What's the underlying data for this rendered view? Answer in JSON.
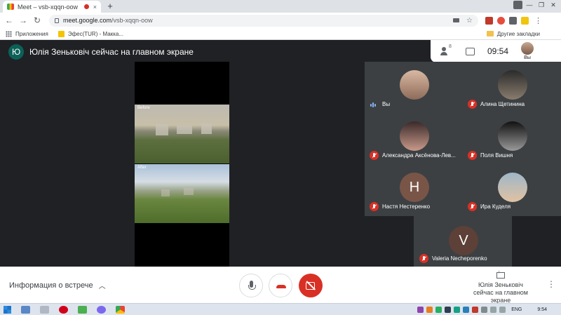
{
  "browser": {
    "tab_title": "Meet – vsb-xqqn-oow",
    "tab_close": "×",
    "new_tab": "+",
    "url_host": "meet.google.com",
    "url_path": "/vsb-xqqn-oow",
    "window_controls": [
      "—",
      "❐",
      "✕"
    ]
  },
  "bookmarks": {
    "apps": "Приложения",
    "efes": "Эфес(TUR) - Макка...",
    "other": "Другие закладки"
  },
  "meet": {
    "presenter_initial": "Ю",
    "presenter_title": "Юлія Зеньковіч сейчас на главном экране",
    "participant_count": "8",
    "clock": "09:54",
    "self_label": "Вы",
    "screen_labels": {
      "before": "Before",
      "after": "After"
    },
    "participants": [
      {
        "name": "Вы",
        "muted": false,
        "initial": ""
      },
      {
        "name": "Алина Щетинина",
        "muted": true,
        "initial": ""
      },
      {
        "name": "Александра Аксёнова-Лев...",
        "muted": true,
        "initial": ""
      },
      {
        "name": "Поля Вишня",
        "muted": true,
        "initial": ""
      },
      {
        "name": "Настя Нестеренко",
        "muted": true,
        "initial": "H"
      },
      {
        "name": "Ира Куделя",
        "muted": true,
        "initial": ""
      },
      {
        "name": "Valeria Necheporenko",
        "muted": true,
        "initial": "V"
      }
    ]
  },
  "controls": {
    "meeting_info": "Информация о встрече",
    "present_line1": "Юлія Зеньковіч",
    "present_line2": "сейчас на главном экране"
  },
  "taskbar": {
    "lang": "ENG",
    "time": "9:54"
  },
  "colors": {
    "meet_bg": "#202124",
    "tile_bg": "#3c4043",
    "mute_red": "#d93025",
    "presenter_avatar": "#0b6158"
  }
}
